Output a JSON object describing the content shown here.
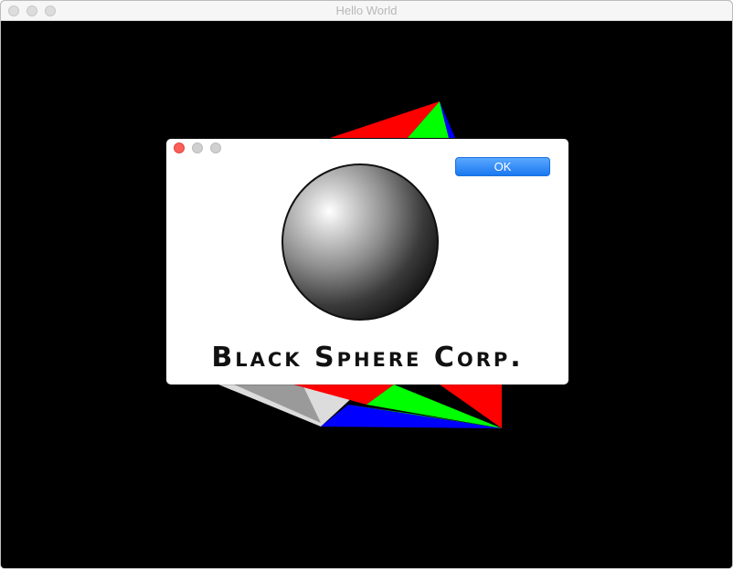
{
  "window": {
    "title": "Hello World"
  },
  "dialog": {
    "ok_label": "OK",
    "logo_text": "Black Sphere Corp."
  },
  "colors": {
    "scene_background": "#000000",
    "facet_red": "#ff0000",
    "facet_green": "#00ff00",
    "facet_blue": "#0000ff",
    "button_blue": "#1a78f0"
  }
}
